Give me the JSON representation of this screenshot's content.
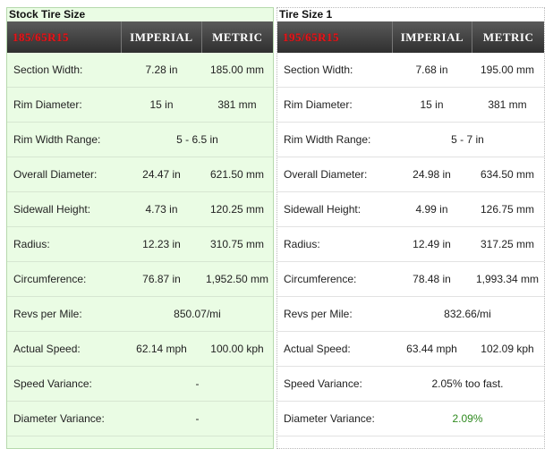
{
  "stock": {
    "title": "Stock Tire Size",
    "size": "185/65R15",
    "col_imperial": "IMPERIAL",
    "col_metric": "METRIC",
    "rows": [
      {
        "label": "Section Width:",
        "imperial": "7.28 in",
        "metric": "185.00 mm"
      },
      {
        "label": "Rim Diameter:",
        "imperial": "15 in",
        "metric": "381 mm"
      },
      {
        "label": "Rim Width Range:",
        "value": "5 - 6.5 in"
      },
      {
        "label": "Overall Diameter:",
        "imperial": "24.47 in",
        "metric": "621.50 mm"
      },
      {
        "label": "Sidewall Height:",
        "imperial": "4.73 in",
        "metric": "120.25 mm"
      },
      {
        "label": "Radius:",
        "imperial": "12.23 in",
        "metric": "310.75 mm"
      },
      {
        "label": "Circumference:",
        "imperial": "76.87 in",
        "metric": "1,952.50 mm"
      },
      {
        "label": "Revs per Mile:",
        "value": "850.07/mi"
      },
      {
        "label": "Actual Speed:",
        "imperial": "62.14 mph",
        "metric": "100.00 kph"
      },
      {
        "label": "Speed Variance:",
        "value": "-"
      },
      {
        "label": "Diameter Variance:",
        "value": "-"
      }
    ]
  },
  "size1": {
    "title": "Tire Size 1",
    "size": "195/65R15",
    "col_imperial": "IMPERIAL",
    "col_metric": "METRIC",
    "rows": [
      {
        "label": "Section Width:",
        "imperial": "7.68 in",
        "metric": "195.00 mm"
      },
      {
        "label": "Rim Diameter:",
        "imperial": "15 in",
        "metric": "381 mm"
      },
      {
        "label": "Rim Width Range:",
        "value": "5 - 7 in"
      },
      {
        "label": "Overall Diameter:",
        "imperial": "24.98 in",
        "metric": "634.50 mm"
      },
      {
        "label": "Sidewall Height:",
        "imperial": "4.99 in",
        "metric": "126.75 mm"
      },
      {
        "label": "Radius:",
        "imperial": "12.49 in",
        "metric": "317.25 mm"
      },
      {
        "label": "Circumference:",
        "imperial": "78.48 in",
        "metric": "1,993.34 mm"
      },
      {
        "label": "Revs per Mile:",
        "value": "832.66/mi"
      },
      {
        "label": "Actual Speed:",
        "imperial": "63.44 mph",
        "metric": "102.09 kph"
      },
      {
        "label": "Speed Variance:",
        "value": "2.05% too fast."
      },
      {
        "label": "Diameter Variance:",
        "value": "2.09%"
      }
    ]
  },
  "colors": {
    "size_text": "#e4161b",
    "variance_positive": "#2f8a1f",
    "stock_bg": "#eafce4"
  }
}
